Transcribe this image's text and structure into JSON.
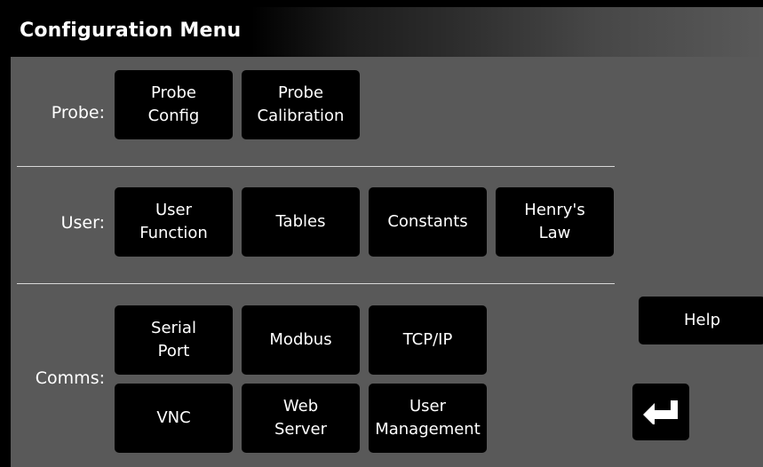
{
  "title": "Configuration Menu",
  "sections": {
    "probe": {
      "label": "Probe:",
      "buttons": [
        "Probe\nConfig",
        "Probe\nCalibration"
      ]
    },
    "user": {
      "label": "User:",
      "buttons": [
        "User\nFunction",
        "Tables",
        "Constants",
        "Henry's\nLaw"
      ]
    },
    "comms": {
      "label": "Comms:",
      "buttons": [
        "Serial\nPort",
        "Modbus",
        "TCP/IP",
        "VNC",
        "Web\nServer",
        "User\nManagement"
      ]
    }
  },
  "side": {
    "help_label": "Help",
    "enter_icon": "return-arrow-icon"
  }
}
